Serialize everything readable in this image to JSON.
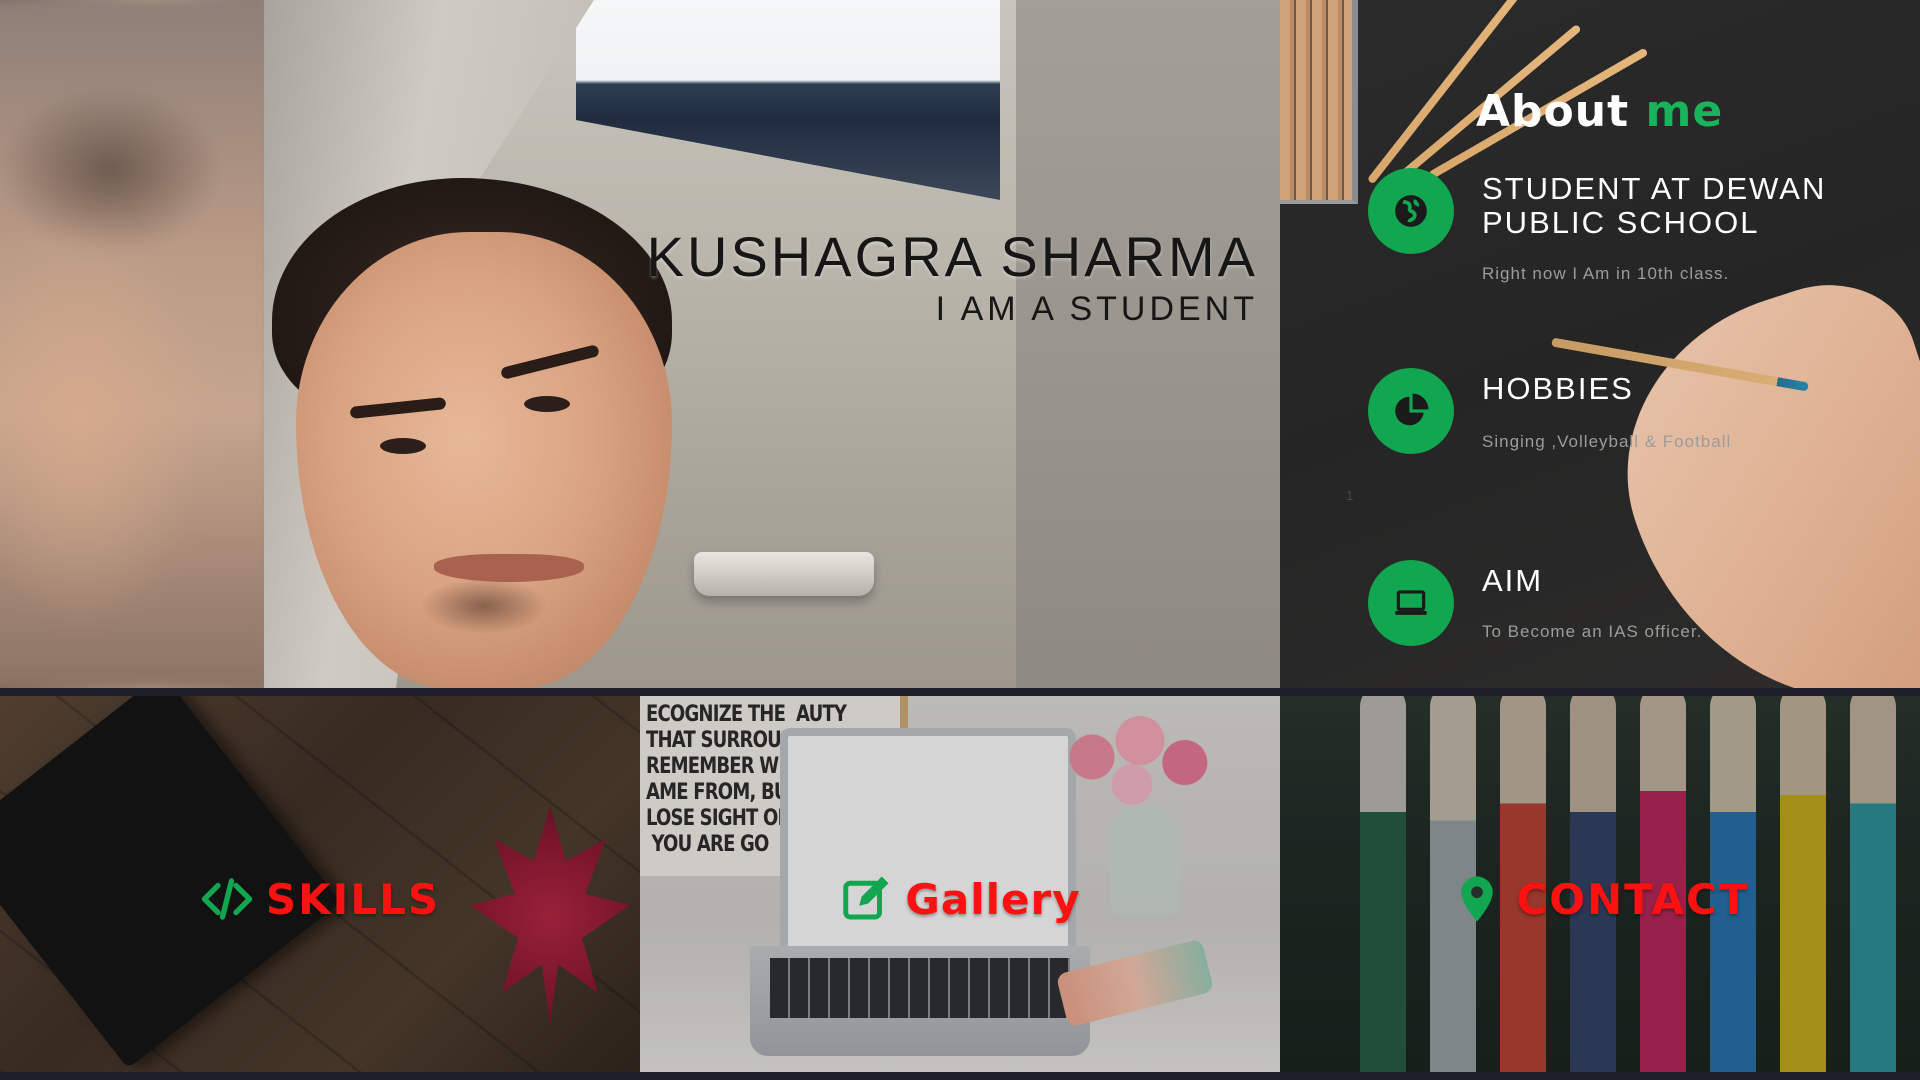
{
  "hero": {
    "name": "KUSHAGRA SHARMA",
    "role": "I AM A STUDENT",
    "photo_icon": "profile-photo"
  },
  "about": {
    "title_main": "About",
    "title_accent": "me",
    "accent_color": "#19b35c",
    "items": [
      {
        "icon": "globe-icon",
        "heading": "STUDENT AT DEWAN PUBLIC SCHOOL",
        "detail": "Right now I Am in 10th class."
      },
      {
        "icon": "pie-chart-icon",
        "heading": "HOBBIES",
        "detail": "Singing ,Volleyball & Football"
      },
      {
        "icon": "laptop-icon",
        "heading": "AIM",
        "detail": "To Become an IAS officer."
      }
    ],
    "marker": "1"
  },
  "tiles": {
    "skills": {
      "label": "SKILLS",
      "icon": "code-icon"
    },
    "gallery": {
      "label": "Gallery",
      "icon": "edit-icon",
      "poster_text": "ECOGNIZE THE  AUTY\nTHAT SURROUN\nREMEMBER WHI\nAME FROM, BU\nLOSE SIGHT OF\n YOU ARE GO"
    },
    "contact": {
      "label": "CONTACT",
      "icon": "map-pin-icon"
    },
    "label_color": "#ff1111",
    "icon_color": "#11a64f"
  }
}
